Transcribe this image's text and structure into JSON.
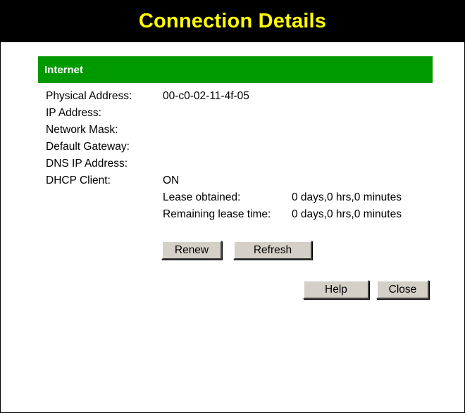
{
  "header": {
    "title": "Connection Details",
    "background_color": "#000000",
    "title_color": "#ffff00"
  },
  "section": {
    "title": "Internet",
    "background_color": "#009900",
    "title_color": "#ffffff"
  },
  "fields": {
    "physical_address": {
      "label": "Physical Address:",
      "value": "00-c0-02-11-4f-05"
    },
    "ip_address": {
      "label": "IP Address:",
      "value": ""
    },
    "network_mask": {
      "label": "Network Mask:",
      "value": ""
    },
    "default_gateway": {
      "label": "Default Gateway:",
      "value": ""
    },
    "dns_ip_address": {
      "label": "DNS IP Address:",
      "value": ""
    },
    "dhcp_client": {
      "label": "DHCP Client:",
      "value": "ON"
    }
  },
  "lease": {
    "obtained_label": "Lease obtained:",
    "obtained_value": "0 days,0 hrs,0 minutes",
    "remaining_label": "Remaining lease time:",
    "remaining_value": "0 days,0 hrs,0 minutes"
  },
  "buttons": {
    "renew": "Renew",
    "refresh": "Refresh",
    "help": "Help",
    "close": "Close"
  }
}
